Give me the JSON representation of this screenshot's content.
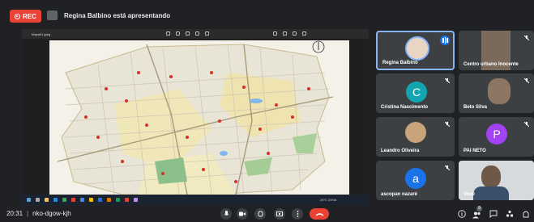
{
  "recording": {
    "label": "REC"
  },
  "presenter": {
    "text": "Regina Balbino está apresentando"
  },
  "viewer": {
    "filename": "Mapa01.jpeg"
  },
  "participants": [
    {
      "name": "Regina Balbino",
      "speaking": true
    },
    {
      "name": "Centro urbano Inocente",
      "muted": true
    },
    {
      "name": "Cristina Nascimento",
      "initial": "C",
      "color": "#12a4af",
      "muted": true
    },
    {
      "name": "Beto Silva",
      "muted": true
    },
    {
      "name": "Leandro Oliveira",
      "muted": true
    },
    {
      "name": "PAI NETO",
      "initial": "P",
      "color": "#a142f4",
      "muted": true
    },
    {
      "name": "ascopan nazaré",
      "initial": "a",
      "color": "#1a73e8",
      "muted": true
    },
    {
      "name": "Você"
    }
  ],
  "meeting": {
    "time": "20:31",
    "separator": "|",
    "code": "nko-dgow-kjh"
  },
  "participant_badge": "9",
  "taskbar": {
    "status": "28°C 29/08"
  },
  "colors": {
    "rec": "#ea4335",
    "accent": "#1a73e8",
    "tile": "#3c4043",
    "background": "#202124"
  }
}
